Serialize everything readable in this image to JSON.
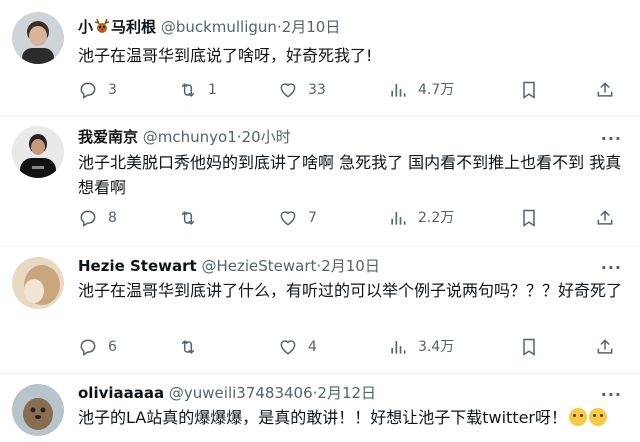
{
  "tweets": [
    {
      "name": "小",
      "name_suffix": "马利根",
      "handle": "@buckmulligun",
      "dot": "·",
      "time": "2月10日",
      "text": "池子在温哥华到底说了啥呀，好奇死我了!",
      "replies": "3",
      "retweets": "1",
      "likes": "33",
      "views": "4.7万"
    },
    {
      "name": "我爱南京",
      "handle": "@mchunyo1",
      "dot": "·",
      "time": "20小时",
      "text": "池子北美脱口秀他妈的到底讲了啥啊 急死我了 国内看不到推上也看不到 我真想看啊",
      "replies": "8",
      "retweets": "",
      "likes": "7",
      "views": "2.2万"
    },
    {
      "name": "Hezie Stewart",
      "handle": "@HezieStewart",
      "dot": "·",
      "time": "2月10日",
      "text": "池子在温哥华到底讲了什么，有听过的可以举个例子说两句吗？？？好奇死了",
      "replies": "6",
      "retweets": "",
      "likes": "4",
      "views": "3.4万"
    },
    {
      "name": "oliviaaaaa",
      "handle": "@yuweili37483406",
      "dot": "·",
      "time": "2月12日",
      "text": "池子的LA站真的爆爆爆，是真的敢讲！！好想让池子下载twitter呀！"
    }
  ],
  "icons": {
    "reply": "reply-icon",
    "retweet": "retweet-icon",
    "like": "heart-icon",
    "views": "views-icon",
    "bookmark": "bookmark-icon",
    "share": "share-icon",
    "more": "more-icon"
  },
  "colors": {
    "text": "#0f1419",
    "secondary": "#536471",
    "divider": "#eff3f4"
  },
  "more_glyph": "···"
}
